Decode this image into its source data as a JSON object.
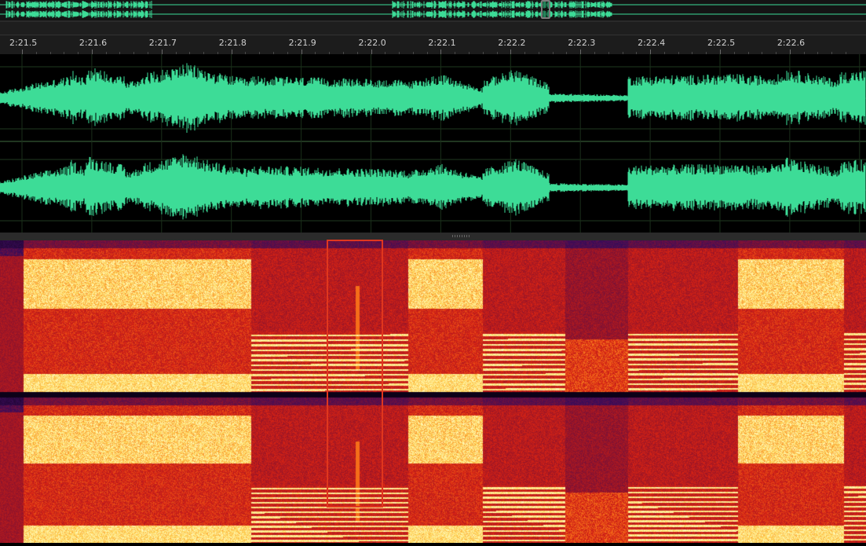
{
  "colors": {
    "waveform": "#3ddc97",
    "background": "#000000",
    "ruler_bg": "#1c1c1c",
    "ruler_text": "#cfcfcf",
    "selection": "#e0371e",
    "spectral_low": "#2a0b45",
    "spectral_mid": "#c2181c",
    "spectral_high": "#ffe96a"
  },
  "ruler": {
    "ticks": [
      "2:21.5",
      "2:21.6",
      "2:21.7",
      "2:21.8",
      "2:21.9",
      "2:22.0",
      "2:22.1",
      "2:22.2",
      "2:22.3",
      "2:22.4",
      "2:22.5",
      "2:22.6"
    ]
  },
  "channels": [
    "left",
    "right"
  ],
  "views": [
    "waveform",
    "spectral-frequency-display"
  ],
  "icons": [
    "overview-navigator",
    "playhead-handle",
    "panel-divider-grip"
  ]
}
